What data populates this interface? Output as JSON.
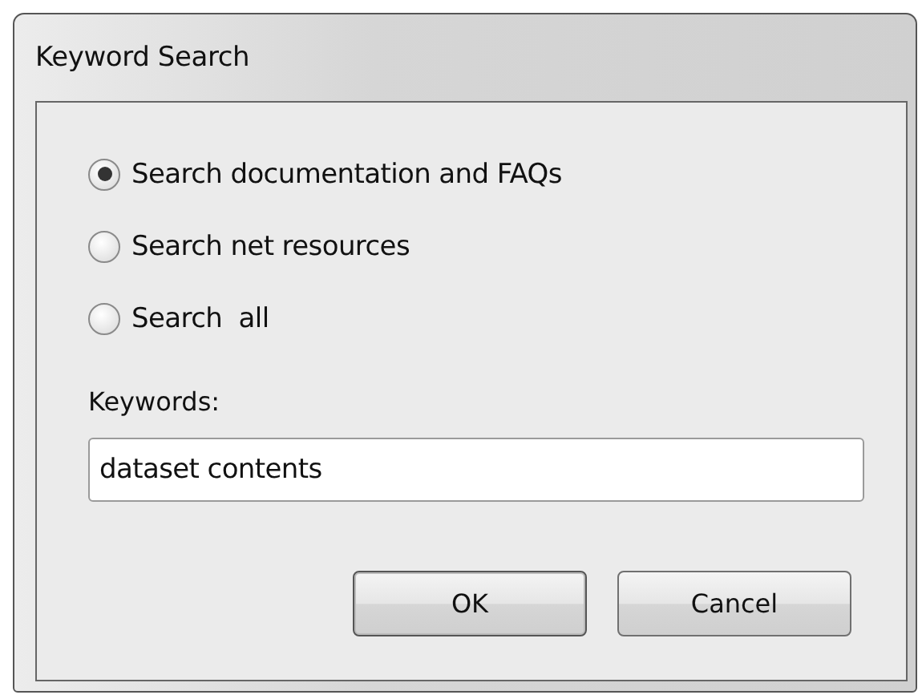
{
  "window": {
    "title": "Keyword Search"
  },
  "search_scope": [
    {
      "label": "Search documentation and FAQs",
      "selected": true
    },
    {
      "label": "Search net resources",
      "selected": false
    },
    {
      "label": "Search  all",
      "selected": false
    }
  ],
  "keywords": {
    "label": "Keywords:",
    "value": "dataset contents"
  },
  "buttons": [
    {
      "label": "OK",
      "default": true
    },
    {
      "label": "Cancel",
      "default": false
    }
  ]
}
